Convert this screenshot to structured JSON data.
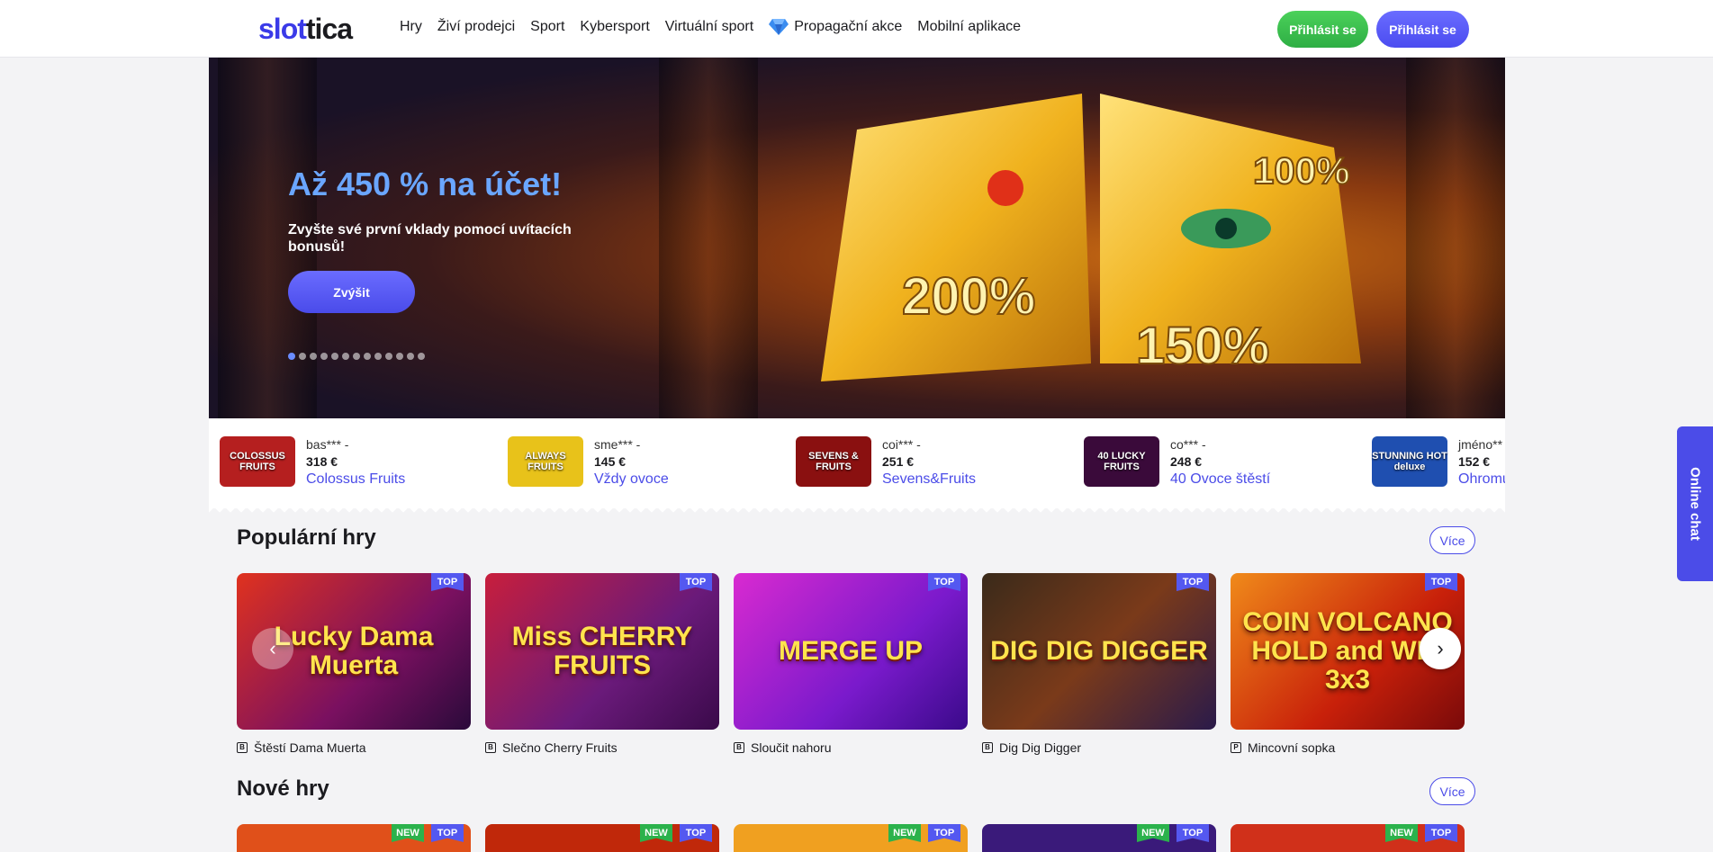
{
  "header": {
    "logo_part1": "slot",
    "logo_part2": "tica",
    "nav": [
      "Hry",
      "Živí prodejci",
      "Sport",
      "Kybersport",
      "Virtuální sport",
      "Propagační akce",
      "Mobilní aplikace"
    ],
    "login_green": "Přihlásit se",
    "login_blue": "Přihlásit se"
  },
  "banner": {
    "title": "Až 450 % na účet!",
    "subtitle": "Zvyšte své první vklady pomocí uvítacích bonusů!",
    "button": "Zvýšit",
    "slide_count": 13,
    "active_slide": 1,
    "bonus_labels": [
      "200%",
      "150%",
      "100%"
    ]
  },
  "winners": [
    {
      "user": "bas*** -",
      "amount": "318 €",
      "game": "Colossus Fruits",
      "thumb_label": "COLOSSUS FRUITS",
      "color": "#b51f1f"
    },
    {
      "user": "sme*** -",
      "amount": "145 €",
      "game": "Vždy ovoce",
      "thumb_label": "ALWAYS FRUITS",
      "color": "#e8c21a"
    },
    {
      "user": "coi*** -",
      "amount": "251 €",
      "game": "Sevens&Fruits",
      "thumb_label": "SEVENS & FRUITS",
      "color": "#8a1010"
    },
    {
      "user": "co*** -",
      "amount": "248 €",
      "game": "40 Ovoce štěstí",
      "thumb_label": "40 LUCKY FRUITS",
      "color": "#3a0a3a"
    },
    {
      "user": "jméno**",
      "amount": "152 €",
      "game": "Ohromu",
      "thumb_label": "STUNNING HOT deluxe",
      "color": "#1f4fb0"
    }
  ],
  "popular": {
    "title": "Populární hry",
    "more": "Více",
    "badge_top": "TOP",
    "games": [
      {
        "name": "Štěstí Dama Muerta",
        "art": "Lucky Dama Muerta",
        "provider": "B",
        "bg": "linear-gradient(135deg,#e0321e,#7a1060 60%,#2a0a3a)"
      },
      {
        "name": "Slečno Cherry Fruits",
        "art": "Miss CHERRY FRUITS",
        "provider": "B",
        "bg": "linear-gradient(135deg,#c81e3c,#6a1a7a 60%,#3a0a4a)"
      },
      {
        "name": "Sloučit nahoru",
        "art": "MERGE UP",
        "provider": "B",
        "bg": "linear-gradient(135deg,#d92ad0,#7a1acc 60%,#3a0a8a)"
      },
      {
        "name": "Dig Dig Digger",
        "art": "DIG DIG DIGGER",
        "provider": "B",
        "bg": "linear-gradient(135deg,#3a2a1a,#7a3a1a 50%,#2a1a4a)"
      },
      {
        "name": "Mincovní sopka",
        "art": "COIN VOLCANO HOLD and WIN 3x3",
        "provider": "P",
        "bg": "linear-gradient(135deg,#f08a1a,#c8200a 60%,#7a0a0a)"
      }
    ]
  },
  "new_games": {
    "title": "Nové hry",
    "more": "Více",
    "badge_new": "NEW",
    "badge_top": "TOP",
    "colors": [
      "#e0501a",
      "#c0280a",
      "#f0a020",
      "#3a1a7a",
      "#d0301a"
    ]
  },
  "chat": {
    "label": "Online chat"
  }
}
